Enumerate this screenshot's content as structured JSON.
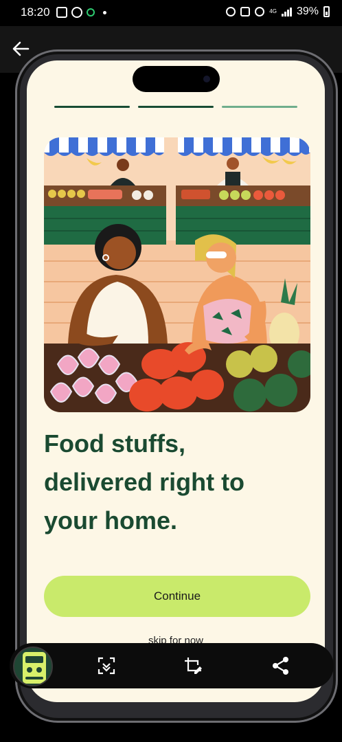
{
  "status_bar": {
    "time": "18:20",
    "battery": "39%",
    "network": "4G"
  },
  "onboarding": {
    "step_total": 3,
    "step_current": 3,
    "title_lines": [
      "Food stuffs,",
      "delivered right to",
      "your home."
    ],
    "continue_label": "Continue",
    "skip_label": "skip for now"
  },
  "colors": {
    "screen_bg": "#fdf7e6",
    "title": "#1a4a31",
    "button": "#c9ea6b",
    "progress_done": "#174c33",
    "progress_active": "#6fae8c"
  },
  "toolbar": {
    "icons": [
      "scan-icon",
      "crop-edit-icon",
      "share-icon"
    ]
  }
}
